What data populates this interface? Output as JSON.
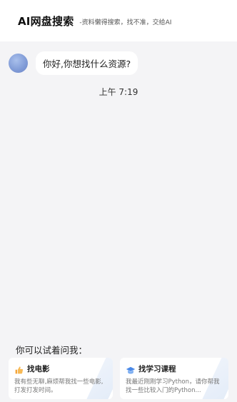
{
  "header": {
    "title": "AI网盘搜索",
    "subtitle": "-资料懒得搜索，找不准，交给AI"
  },
  "chat": {
    "greeting": "你好,你想找什么资源?",
    "timestamp": "上午 7:19"
  },
  "suggestions": {
    "title": "你可以试着问我：",
    "items": [
      {
        "icon": "thumbs-up-icon",
        "label": "找电影",
        "desc": "我有些无聊,麻烦帮我找一些电影,打发打发时间。"
      },
      {
        "icon": "graduation-cap-icon",
        "label": "找学习课程",
        "desc": "我最近刚刚学习Python，请你帮我找一些比较入门的Python..."
      }
    ]
  },
  "colors": {
    "background": "#f4f4f6",
    "header": "#ffffff",
    "avatar": "#7f9ad6",
    "accent_icon_blue": "#4a89e8",
    "accent_icon_orange": "#f4a53a"
  }
}
